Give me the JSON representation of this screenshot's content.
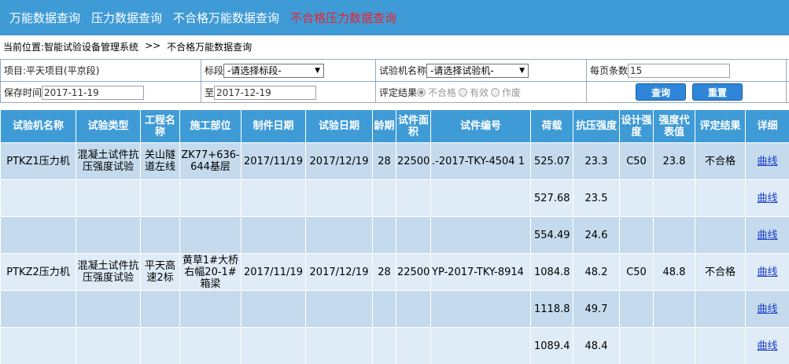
{
  "nav": {
    "items": [
      "万能数据查询",
      "压力数据查询",
      "不合格万能数据查询",
      "不合格压力数据查询"
    ],
    "active_index": 3,
    "accent": "#e8232f",
    "bar_color": "#3f9bd6"
  },
  "breadcrumb": {
    "prefix": "当前位置:",
    "system": "智能试验设备管理系统",
    "separator": ">>",
    "current": "不合格万能数据查询"
  },
  "filter": {
    "project_label": "项目:平天项目(平京段)",
    "section_label": "标段",
    "section_value": "-请选择标段-",
    "machine_label": "试验机名称",
    "machine_value": "-请选择试验机-",
    "page_size_label": "每页条数",
    "page_size_value": "15",
    "save_time_label": "保存时间",
    "date_from": "2017-11-19",
    "to_label": "至",
    "date_to": "2017-12-19",
    "result_label": "评定结果",
    "result_options": [
      "不合格",
      "有效",
      "作废"
    ],
    "result_selected": "不合格",
    "query_button": "查询",
    "reset_button": "重置"
  },
  "table": {
    "headers": [
      "试验机名称",
      "试验类型",
      "工程名称",
      "施工部位",
      "制件日期",
      "试验日期",
      "龄期",
      "试件面积",
      "试件编号",
      "荷载",
      "抗压强度",
      "设计强度",
      "强度代表值",
      "评定结果",
      "详细"
    ],
    "rows": [
      {
        "machine": "PTKZ1压力机",
        "type": "混凝土试件抗压强度试验",
        "project": "关山隧道左线",
        "part": "ZK77+636-644基层",
        "make_date": "2017/11/19",
        "test_date": "2017/12/19",
        "age": "28",
        "area": "22500",
        "sample_no": ".-2017-TKY-4504  1",
        "load": "525.07",
        "strength": "23.3",
        "design": "C50",
        "rep": "23.8",
        "result": "不合格",
        "detail": "曲线",
        "shade": "dark"
      },
      {
        "machine": "",
        "type": "",
        "project": "",
        "part": "",
        "make_date": "",
        "test_date": "",
        "age": "",
        "area": "",
        "sample_no": "",
        "load": "527.68",
        "strength": "23.5",
        "design": "",
        "rep": "",
        "result": "",
        "detail": "曲线",
        "shade": "light"
      },
      {
        "machine": "",
        "type": "",
        "project": "",
        "part": "",
        "make_date": "",
        "test_date": "",
        "age": "",
        "area": "",
        "sample_no": "",
        "load": "554.49",
        "strength": "24.6",
        "design": "",
        "rep": "",
        "result": "",
        "detail": "曲线",
        "shade": "dark"
      },
      {
        "machine": "PTKZ2压力机",
        "type": "混凝土试件抗压强度试验",
        "project": "平天高速2标",
        "part": "黄草1#大桥右幅20-1#箱梁",
        "make_date": "2017/11/19",
        "test_date": "2017/12/19",
        "age": "28",
        "area": "22500",
        "sample_no": "YP-2017-TKY-8914",
        "load": "1084.8",
        "strength": "48.2",
        "design": "C50",
        "rep": "48.8",
        "result": "不合格",
        "detail": "曲线",
        "shade": "light"
      },
      {
        "machine": "",
        "type": "",
        "project": "",
        "part": "",
        "make_date": "",
        "test_date": "",
        "age": "",
        "area": "",
        "sample_no": "",
        "load": "1118.8",
        "strength": "49.7",
        "design": "",
        "rep": "",
        "result": "",
        "detail": "曲线",
        "shade": "dark"
      },
      {
        "machine": "",
        "type": "",
        "project": "",
        "part": "",
        "make_date": "",
        "test_date": "",
        "age": "",
        "area": "",
        "sample_no": "",
        "load": "1089.4",
        "strength": "48.4",
        "design": "",
        "rep": "",
        "result": "",
        "detail": "曲线",
        "shade": "light"
      }
    ]
  }
}
